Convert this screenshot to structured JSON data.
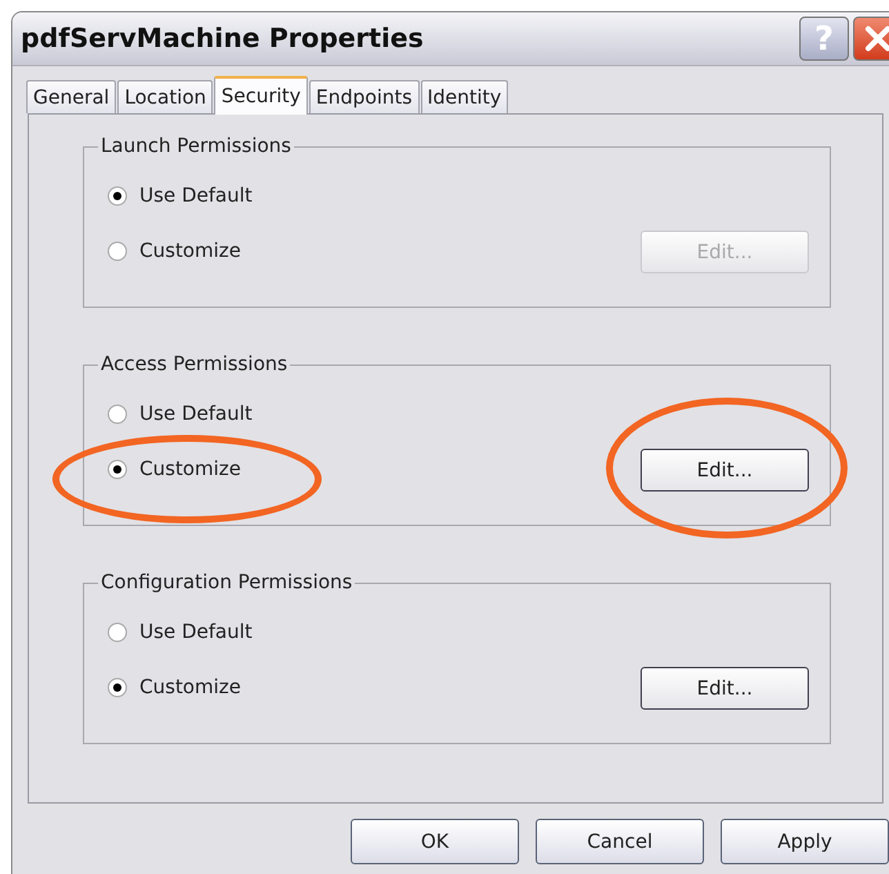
{
  "window": {
    "title": "pdfServMachine Properties",
    "help_button": "?"
  },
  "tabs": [
    {
      "label": "General",
      "selected": false
    },
    {
      "label": "Location",
      "selected": false
    },
    {
      "label": "Security",
      "selected": true
    },
    {
      "label": "Endpoints",
      "selected": false
    },
    {
      "label": "Identity",
      "selected": false
    }
  ],
  "groups": [
    {
      "title": "Launch Permissions",
      "options": [
        {
          "label": "Use Default",
          "selected": true,
          "circled": false
        },
        {
          "label": "Customize",
          "selected": false,
          "circled": false
        }
      ],
      "edit_button": {
        "label": "Edit...",
        "disabled": true,
        "circled": false
      }
    },
    {
      "title": "Access Permissions",
      "options": [
        {
          "label": "Use Default",
          "selected": false,
          "circled": false
        },
        {
          "label": "Customize",
          "selected": true,
          "circled": true
        }
      ],
      "edit_button": {
        "label": "Edit...",
        "disabled": false,
        "circled": true
      }
    },
    {
      "title": "Configuration Permissions",
      "options": [
        {
          "label": "Use Default",
          "selected": false,
          "circled": false
        },
        {
          "label": "Customize",
          "selected": true,
          "circled": false
        }
      ],
      "edit_button": {
        "label": "Edit...",
        "disabled": false,
        "circled": false
      }
    }
  ],
  "buttons": [
    {
      "label": "OK"
    },
    {
      "label": "Cancel"
    },
    {
      "label": "Apply"
    }
  ]
}
